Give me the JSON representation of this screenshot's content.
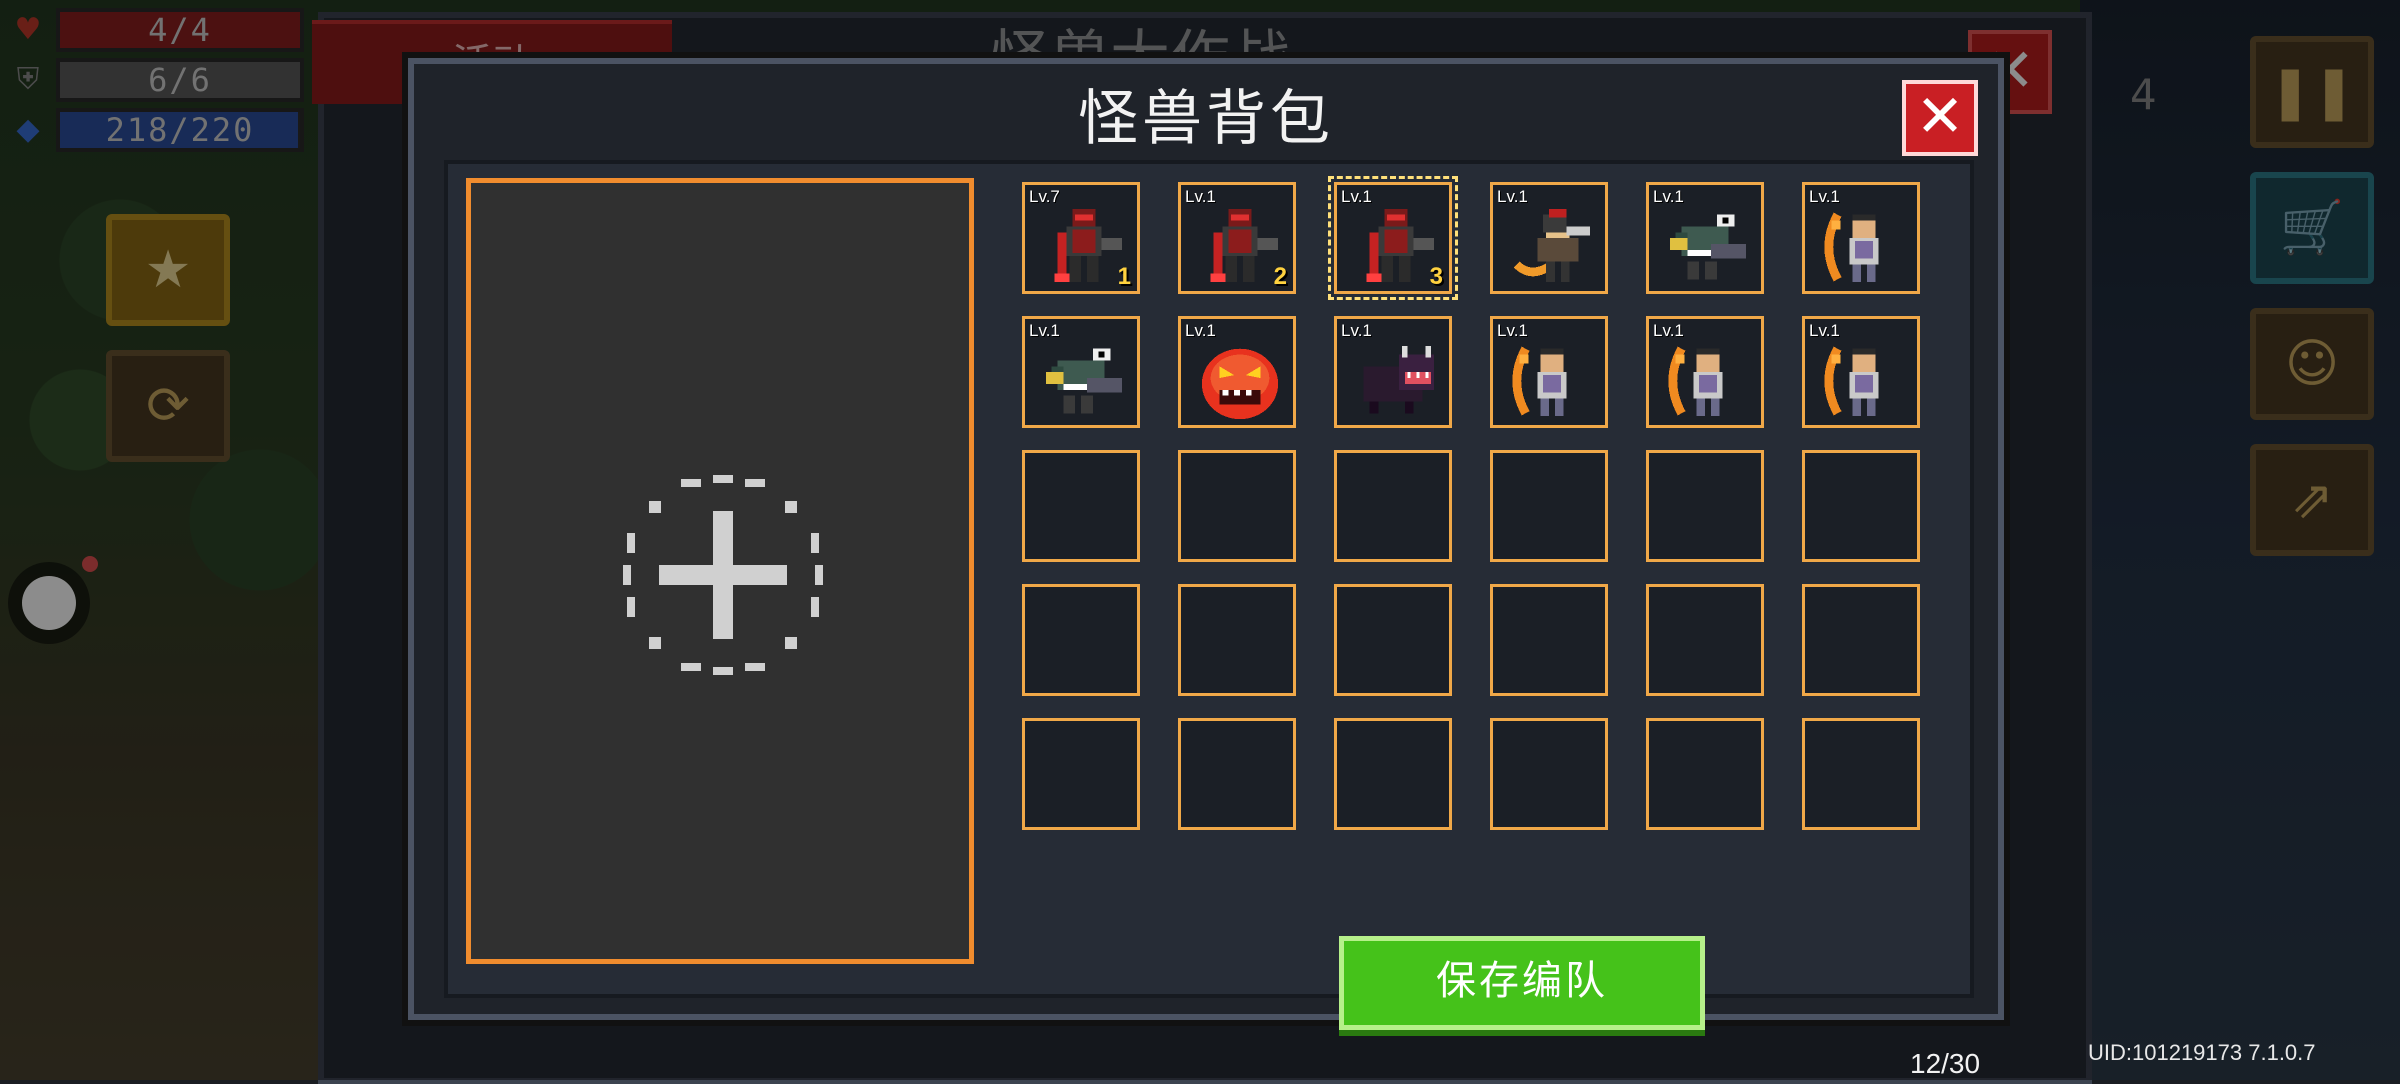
{
  "hud": {
    "hp": {
      "text": "4/4",
      "fill": 1.0
    },
    "armor": {
      "text": "6/6",
      "fill": 1.0
    },
    "energy": {
      "text": "218/220",
      "fill": 0.99
    }
  },
  "background": {
    "tab_label": "活动",
    "back_title": "怪兽大作战",
    "counter": "4"
  },
  "dialog": {
    "title": "怪兽背包",
    "close_label": "✕",
    "save_label": "保存编队",
    "capacity": "12/30"
  },
  "slots": [
    {
      "level": "Lv.7",
      "badge": "1",
      "monster": "red-knight",
      "selected": false
    },
    {
      "level": "Lv.1",
      "badge": "2",
      "monster": "red-knight",
      "selected": false
    },
    {
      "level": "Lv.1",
      "badge": "3",
      "monster": "red-knight",
      "selected": true
    },
    {
      "level": "Lv.1",
      "badge": "",
      "monster": "scythe-warrior",
      "selected": false
    },
    {
      "level": "Lv.1",
      "badge": "",
      "monster": "shark-gunner",
      "selected": false
    },
    {
      "level": "Lv.1",
      "badge": "",
      "monster": "monk-bow",
      "selected": false
    },
    {
      "level": "Lv.1",
      "badge": "",
      "monster": "shark-gunner",
      "selected": false
    },
    {
      "level": "Lv.1",
      "badge": "",
      "monster": "fire-slime",
      "selected": false
    },
    {
      "level": "Lv.1",
      "badge": "",
      "monster": "dark-boar",
      "selected": false
    },
    {
      "level": "Lv.1",
      "badge": "",
      "monster": "monk-bow",
      "selected": false
    },
    {
      "level": "Lv.1",
      "badge": "",
      "monster": "monk-bow",
      "selected": false
    },
    {
      "level": "Lv.1",
      "badge": "",
      "monster": "monk-bow",
      "selected": false
    },
    {
      "level": "",
      "badge": "",
      "monster": "",
      "selected": false
    },
    {
      "level": "",
      "badge": "",
      "monster": "",
      "selected": false
    },
    {
      "level": "",
      "badge": "",
      "monster": "",
      "selected": false
    },
    {
      "level": "",
      "badge": "",
      "monster": "",
      "selected": false
    },
    {
      "level": "",
      "badge": "",
      "monster": "",
      "selected": false
    },
    {
      "level": "",
      "badge": "",
      "monster": "",
      "selected": false
    },
    {
      "level": "",
      "badge": "",
      "monster": "",
      "selected": false
    },
    {
      "level": "",
      "badge": "",
      "monster": "",
      "selected": false
    },
    {
      "level": "",
      "badge": "",
      "monster": "",
      "selected": false
    },
    {
      "level": "",
      "badge": "",
      "monster": "",
      "selected": false
    },
    {
      "level": "",
      "badge": "",
      "monster": "",
      "selected": false
    },
    {
      "level": "",
      "badge": "",
      "monster": "",
      "selected": false
    },
    {
      "level": "",
      "badge": "",
      "monster": "",
      "selected": false
    },
    {
      "level": "",
      "badge": "",
      "monster": "",
      "selected": false
    },
    {
      "level": "",
      "badge": "",
      "monster": "",
      "selected": false
    },
    {
      "level": "",
      "badge": "",
      "monster": "",
      "selected": false
    },
    {
      "level": "",
      "badge": "",
      "monster": "",
      "selected": false
    },
    {
      "level": "",
      "badge": "",
      "monster": "",
      "selected": false
    }
  ],
  "footer": {
    "uid": "UID:101219173 7.1.0.7"
  },
  "colors": {
    "slot_border": "#f0a848",
    "save_button": "#45c21a",
    "close_button": "#c91f24",
    "preview_border": "#f08c2e"
  }
}
